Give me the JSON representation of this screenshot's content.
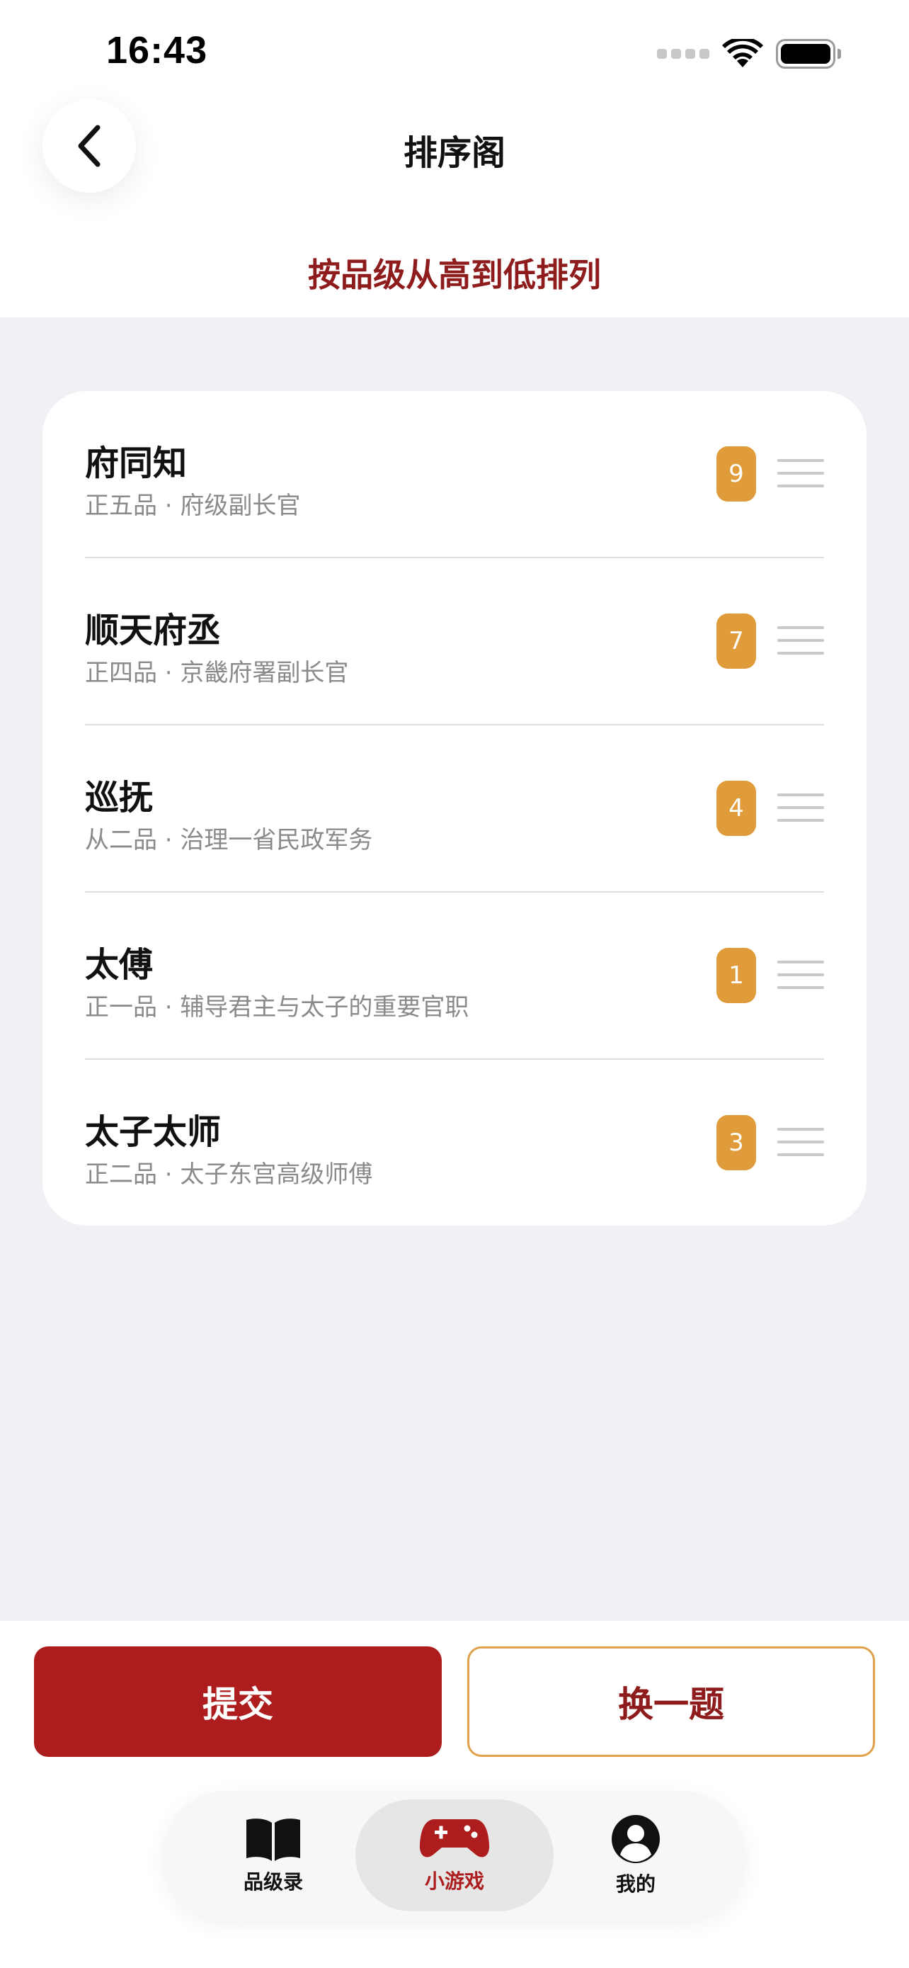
{
  "status_bar": {
    "time": "16:43"
  },
  "header": {
    "title": "排序阁",
    "instruction": "按品级从高到低排列"
  },
  "items": [
    {
      "title": "府同知",
      "subtitle": "正五品 · 府级副长官",
      "badge": "9"
    },
    {
      "title": "顺天府丞",
      "subtitle": "正四品 · 京畿府署副长官",
      "badge": "7"
    },
    {
      "title": "巡抚",
      "subtitle": "从二品 · 治理一省民政军务",
      "badge": "4"
    },
    {
      "title": "太傅",
      "subtitle": "正一品 · 辅导君主与太子的重要官职",
      "badge": "1"
    },
    {
      "title": "太子太师",
      "subtitle": "正二品 · 太子东宫高级师傅",
      "badge": "3"
    }
  ],
  "actions": {
    "submit": "提交",
    "next": "换一题"
  },
  "tabbar": {
    "tabs": [
      {
        "label": "品级录",
        "icon": "book-icon"
      },
      {
        "label": "小游戏",
        "icon": "gamepad-icon",
        "active": true
      },
      {
        "label": "我的",
        "icon": "profile-icon"
      }
    ]
  },
  "colors": {
    "accent_red": "#ad1d1d",
    "instruction_red": "#8f1c1c",
    "badge_orange": "#e09c3a",
    "background": "#f0f0f5"
  }
}
